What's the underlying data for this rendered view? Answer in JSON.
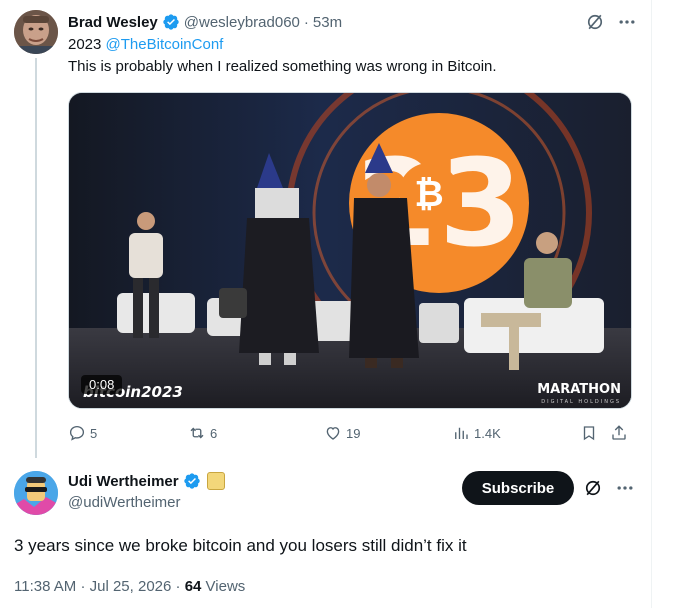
{
  "quoted_tweet": {
    "author_name": "Brad Wesley",
    "author_handle": "@wesleybrad060",
    "time_ago": "53m",
    "line1_prefix": "2023 ",
    "line1_mention": "@TheBitcoinConf",
    "line2": "This is probably when I realized something was wrong in Bitcoin.",
    "video_timestamp": "0:08",
    "video_overlay_left": "bitcoin2023",
    "video_overlay_right": "MARATHON",
    "video_overlay_right_sub": "DIGITAL HOLDINGS",
    "stats": {
      "replies": "5",
      "reposts": "6",
      "likes": "19",
      "views": "1.4K"
    }
  },
  "main_tweet": {
    "author_name": "Udi Wertheimer",
    "author_handle": "@udiWertheimer",
    "subscribe_label": "Subscribe",
    "text": "3 years since we broke bitcoin and you losers still didn’t fix it",
    "time": "11:38 AM",
    "date": "Jul 25, 2026",
    "views_count": "64",
    "views_label": "Views"
  },
  "colors": {
    "accent": "#1d9bf0",
    "text_primary": "#0f1419",
    "text_secondary": "#536471"
  }
}
